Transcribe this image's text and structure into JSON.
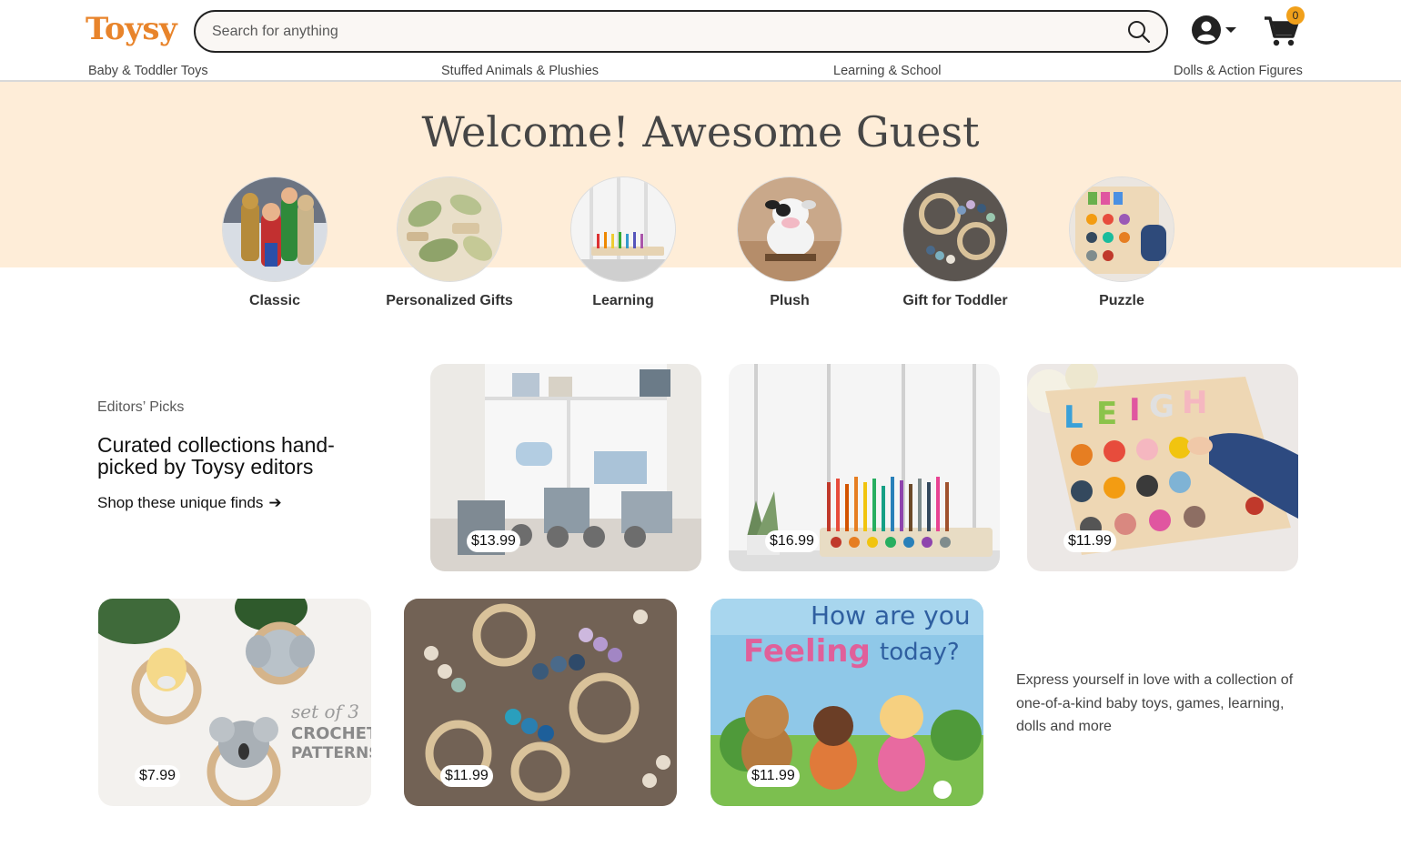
{
  "header": {
    "logo": "Toysy",
    "search_placeholder": "Search for anything",
    "cart_count": "0"
  },
  "nav": [
    "Baby & Toddler Toys",
    "Stuffed Animals & Plushies",
    "Learning & School",
    "Dolls & Action Figures"
  ],
  "hero": {
    "welcome": "Welcome! Awesome Guest",
    "categories": [
      {
        "label": "Classic"
      },
      {
        "label": "Personalized Gifts"
      },
      {
        "label": "Learning"
      },
      {
        "label": "Plush"
      },
      {
        "label": "Gift for Toddler"
      },
      {
        "label": "Puzzle"
      }
    ]
  },
  "editors_picks": {
    "kicker": "Editors’ Picks",
    "title": "Curated collections hand-picked by Toysy editors",
    "link": "Shop these unique finds",
    "link_arrow": "➔"
  },
  "products": [
    {
      "price": "$13.99"
    },
    {
      "price": "$16.99"
    },
    {
      "price": "$11.99"
    },
    {
      "price": "$7.99",
      "overlay_text": [
        "set of 3",
        "CROCHET",
        "PATTERNS"
      ]
    },
    {
      "price": "$11.99"
    },
    {
      "price": "$11.99",
      "overlay_text": [
        "How are you",
        "Feeling",
        "today?"
      ]
    }
  ],
  "blurb": "Express yourself in love with a collection of one-of-a-kind baby toys, games, learning, dolls and more",
  "colors": {
    "brand": "#e8842b",
    "hero_bg": "#feedd8",
    "badge": "#f1a01a"
  }
}
